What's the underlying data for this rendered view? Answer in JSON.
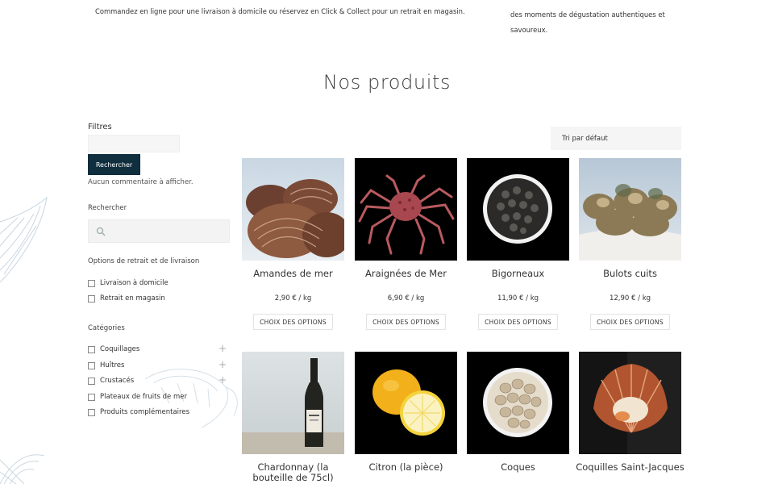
{
  "intro": {
    "left_text": "Commandez en ligne pour une livraison à domicile ou réservez en Click & Collect pour un retrait en magasin.",
    "right_text": "des moments de dégustation authentiques et savoureux."
  },
  "section_title": "Nos produits",
  "filters": {
    "title": "Filtres",
    "search_button": "Rechercher",
    "no_comment": "Aucun commentaire à afficher.",
    "search_heading": "Rechercher",
    "delivery_heading": "Options de retrait et de livraison",
    "delivery_options": [
      "Livraison à domicile",
      "Retrait en magasin"
    ],
    "categories_heading": "Catégories",
    "categories": [
      "Coquillages",
      "Huîtres",
      "Crustacés",
      "Plateaux de fruits de mer",
      "Produits complémentaires"
    ]
  },
  "sort": {
    "selected": "Tri par défaut"
  },
  "products": [
    {
      "name": "Amandes de mer",
      "price": "2,90 € / kg",
      "button": "CHOIX DES OPTIONS"
    },
    {
      "name": "Araignées de Mer",
      "price": "6,90 € / kg",
      "button": "CHOIX DES OPTIONS"
    },
    {
      "name": "Bigorneaux",
      "price": "11,90 € / kg",
      "button": "CHOIX DES OPTIONS"
    },
    {
      "name": "Bulots cuits",
      "price": "12,90 € / kg",
      "button": "CHOIX DES OPTIONS"
    },
    {
      "name": "Chardonnay (la bouteille de 75cl)"
    },
    {
      "name": "Citron (la pièce)"
    },
    {
      "name": "Coques"
    },
    {
      "name": "Coquilles Saint-Jacques"
    }
  ],
  "colors": {
    "accent": "#0f2e3e",
    "background": "#ffffff",
    "input_bg": "#f5f5f5"
  }
}
